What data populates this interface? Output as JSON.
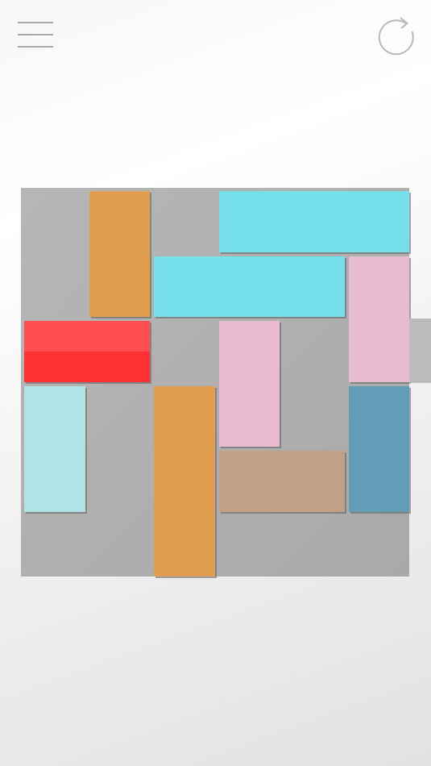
{
  "toolbar": {
    "menu_icon": "hamburger-menu-icon",
    "restart_icon": "restart-arrow-icon",
    "icon_color": "#a9a9a9"
  },
  "board": {
    "grid_columns": 6,
    "grid_rows": 6,
    "background": [
      "#b6b6b6",
      "#a9a9a9"
    ],
    "exit_side": "right",
    "exit_row": 3
  },
  "blocks": [
    {
      "id": "orange-vertical-top",
      "col": 2,
      "row": 1,
      "w": 1,
      "h": 2,
      "color": "#df9f4f"
    },
    {
      "id": "cyan-horizontal-top",
      "col": 4,
      "row": 1,
      "w": 3,
      "h": 1,
      "color": "#75dfea"
    },
    {
      "id": "cyan-horizontal-middle",
      "col": 3,
      "row": 2,
      "w": 3,
      "h": 1,
      "color": "#75dfea"
    },
    {
      "id": "pink-vertical-right",
      "col": 6,
      "row": 2,
      "w": 1,
      "h": 2,
      "color": "#e8bbd0"
    },
    {
      "id": "red-target-block",
      "col": 1,
      "row": 3,
      "w": 2,
      "h": 1,
      "color": "#ff3134",
      "target": true
    },
    {
      "id": "pink-vertical-center",
      "col": 4,
      "row": 3,
      "w": 1,
      "h": 2,
      "color": "#e8bbd0"
    },
    {
      "id": "light-cyan-vertical-left",
      "col": 1,
      "row": 4,
      "w": 1,
      "h": 2,
      "color": "#b1e2e5"
    },
    {
      "id": "orange-vertical-bottom",
      "col": 3,
      "row": 4,
      "w": 1,
      "h": 3,
      "color": "#df9f4f"
    },
    {
      "id": "steel-blue-vertical-right",
      "col": 6,
      "row": 4,
      "w": 1,
      "h": 2,
      "color": "#629db8"
    },
    {
      "id": "tan-horizontal-bottom",
      "col": 4,
      "row": 5,
      "w": 2,
      "h": 1,
      "color": "#c0a188"
    }
  ]
}
